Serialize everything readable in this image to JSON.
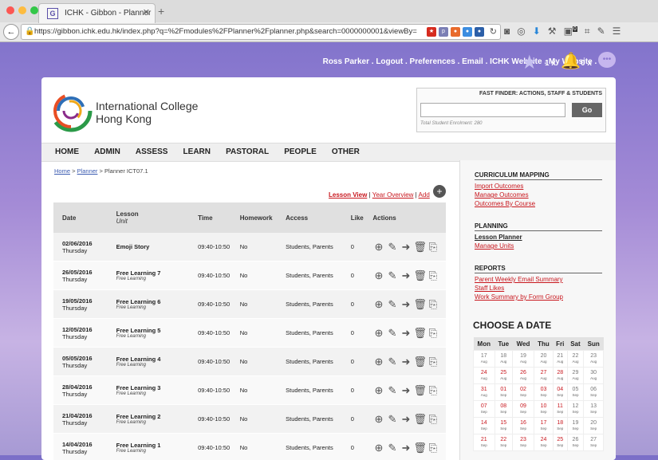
{
  "browser": {
    "tab_title": "ICHK - Gibbon - Planner",
    "tab_favicon": "G",
    "url": "https://gibbon.ichk.edu.hk/index.php?q=%2Fmodules%2FPlanner%2Fplanner.php&search=0000000001&viewBy=class&gibbonC",
    "ext_badge": "0"
  },
  "userbar": {
    "name": "Ross Parker",
    "logout": "Logout",
    "preferences": "Preferences",
    "email": "Email",
    "website": "ICHK Website",
    "my_website": "My Website",
    "sep": " . ",
    "count0": "0 x",
    "likes": "1 x",
    "alerts": "0 x"
  },
  "school": {
    "name_line1": "International College",
    "name_line2": "Hong Kong"
  },
  "finder": {
    "title": "FAST FINDER: ACTIONS, STAFF & STUDENTS",
    "go": "Go",
    "enrolment": "Total Student Enrolment: 280"
  },
  "menu": [
    "HOME",
    "ADMIN",
    "ASSESS",
    "LEARN",
    "PASTORAL",
    "PEOPLE",
    "OTHER"
  ],
  "breadcrumb": {
    "home": "Home",
    "planner": "Planner",
    "current": "Planner ICT07.1"
  },
  "views": {
    "lesson": "Lesson View",
    "year": "Year Overview",
    "add": "Add"
  },
  "table": {
    "headers": {
      "date": "Date",
      "lesson": "Lesson",
      "unit": "Unit",
      "time": "Time",
      "homework": "Homework",
      "access": "Access",
      "like": "Like",
      "actions": "Actions"
    },
    "rows": [
      {
        "date": "02/06/2016",
        "day": "Thursday",
        "lesson": "Emoji Story",
        "unit": "",
        "time": "09:40-10:50",
        "homework": "No",
        "access": "Students, Parents",
        "like": "0"
      },
      {
        "date": "26/05/2016",
        "day": "Thursday",
        "lesson": "Free Learning 7",
        "unit": "Free Learning",
        "time": "09:40-10:50",
        "homework": "No",
        "access": "Students, Parents",
        "like": "0"
      },
      {
        "date": "19/05/2016",
        "day": "Thursday",
        "lesson": "Free Learning 6",
        "unit": "Free Learning",
        "time": "09:40-10:50",
        "homework": "No",
        "access": "Students, Parents",
        "like": "0"
      },
      {
        "date": "12/05/2016",
        "day": "Thursday",
        "lesson": "Free Learning 5",
        "unit": "Free Learning",
        "time": "09:40-10:50",
        "homework": "No",
        "access": "Students, Parents",
        "like": "0"
      },
      {
        "date": "05/05/2016",
        "day": "Thursday",
        "lesson": "Free Learning 4",
        "unit": "Free Learning",
        "time": "09:40-10:50",
        "homework": "No",
        "access": "Students, Parents",
        "like": "0"
      },
      {
        "date": "28/04/2016",
        "day": "Thursday",
        "lesson": "Free Learning 3",
        "unit": "Free Learning",
        "time": "09:40-10:50",
        "homework": "No",
        "access": "Students, Parents",
        "like": "0"
      },
      {
        "date": "21/04/2016",
        "day": "Thursday",
        "lesson": "Free Learning 2",
        "unit": "Free Learning",
        "time": "09:40-10:50",
        "homework": "No",
        "access": "Students, Parents",
        "like": "0"
      },
      {
        "date": "14/04/2016",
        "day": "Thursday",
        "lesson": "Free Learning 1",
        "unit": "Free Learning",
        "time": "09:40-10:50",
        "homework": "No",
        "access": "Students, Parents",
        "like": "0"
      }
    ]
  },
  "sidebar": {
    "curriculum_heading": "CURRICULUM MAPPING",
    "import_outcomes": "Import Outcomes",
    "manage_outcomes": "Manage Outcomes",
    "outcomes_by_course": "Outcomes By Course",
    "planning_heading": "PLANNING",
    "lesson_planner": "Lesson Planner",
    "manage_units": "Manage Units",
    "reports_heading": "REPORTS",
    "parent_weekly": "Parent Weekly Email Summary",
    "staff_likes": "Staff Likes",
    "work_summary": "Work Summary by Form Group"
  },
  "calendar": {
    "title": "CHOOSE A DATE",
    "days": [
      "Mon",
      "Tue",
      "Wed",
      "Thu",
      "Fri",
      "Sat",
      "Sun"
    ],
    "weeks": [
      [
        [
          "17",
          "Aug"
        ],
        [
          "18",
          "Aug"
        ],
        [
          "19",
          "Aug"
        ],
        [
          "20",
          "Aug"
        ],
        [
          "21",
          "Aug"
        ],
        [
          "22",
          "Aug"
        ],
        [
          "23",
          "Aug"
        ]
      ],
      [
        [
          "24",
          "Aug"
        ],
        [
          "25",
          "Aug"
        ],
        [
          "26",
          "Aug"
        ],
        [
          "27",
          "Aug"
        ],
        [
          "28",
          "Aug"
        ],
        [
          "29",
          "Aug"
        ],
        [
          "30",
          "Aug"
        ]
      ],
      [
        [
          "31",
          "Aug"
        ],
        [
          "01",
          "Sep"
        ],
        [
          "02",
          "Sep"
        ],
        [
          "03",
          "Sep"
        ],
        [
          "04",
          "Sep"
        ],
        [
          "05",
          "Sep"
        ],
        [
          "06",
          "Sep"
        ]
      ],
      [
        [
          "07",
          "Sep"
        ],
        [
          "08",
          "Sep"
        ],
        [
          "09",
          "Sep"
        ],
        [
          "10",
          "Sep"
        ],
        [
          "11",
          "Sep"
        ],
        [
          "12",
          "Sep"
        ],
        [
          "13",
          "Sep"
        ]
      ],
      [
        [
          "14",
          "Sep"
        ],
        [
          "15",
          "Sep"
        ],
        [
          "16",
          "Sep"
        ],
        [
          "17",
          "Sep"
        ],
        [
          "18",
          "Sep"
        ],
        [
          "19",
          "Sep"
        ],
        [
          "20",
          "Sep"
        ]
      ],
      [
        [
          "21",
          "Sep"
        ],
        [
          "22",
          "Sep"
        ],
        [
          "23",
          "Sep"
        ],
        [
          "24",
          "Sep"
        ],
        [
          "25",
          "Sep"
        ],
        [
          "26",
          "Sep"
        ],
        [
          "27",
          "Sep"
        ]
      ]
    ],
    "colors": {
      "school_day": "#c8171e",
      "other_day": "#777777"
    }
  },
  "colors": {
    "accent_link": "#c8171e",
    "breadcrumb_link": "#3a5ab0",
    "go_button": "#666666"
  }
}
